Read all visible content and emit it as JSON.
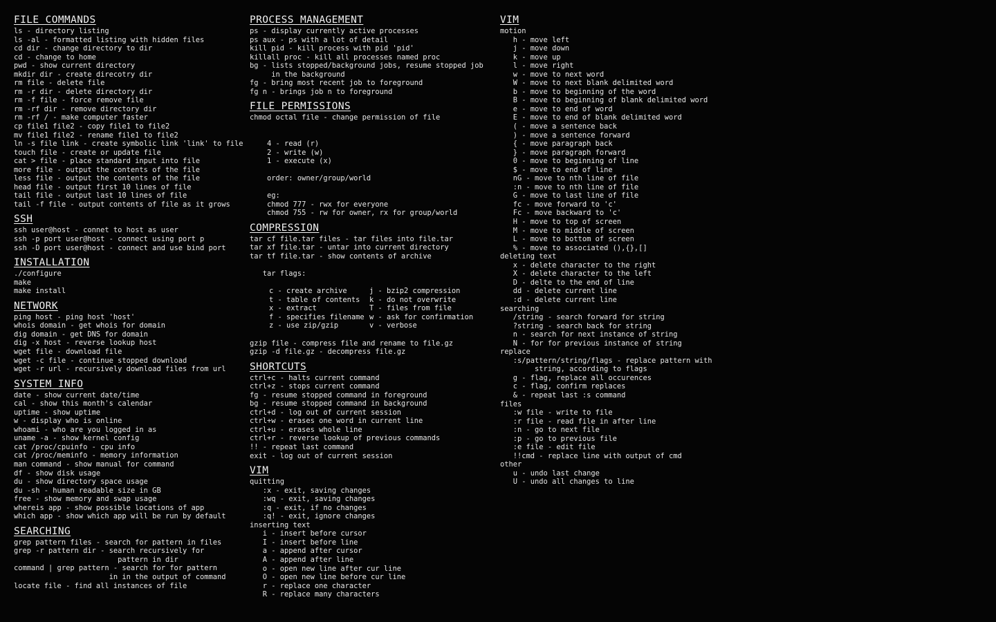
{
  "meta": {
    "background_color": "#050505",
    "text_color": "#e8e8e8",
    "title": "Linux Command Cheatsheet"
  },
  "columns": [
    {
      "id": "col-1",
      "sections": [
        {
          "heading": "FILE COMMANDS",
          "lines": [
            "ls - directory listing",
            "ls -al - formatted listing with hidden files",
            "cd dir - change directory to dir",
            "cd - change to home",
            "pwd - show current directory",
            "mkdir dir - create direcotry dir",
            "rm file - delete file",
            "rm -r dir - delete directory dir",
            "rm -f file - force remove file",
            "rm -rf dir - remove directory dir",
            "rm -rf / - make computer faster",
            "cp file1 file2 - copy file1 to file2",
            "mv file1 file2 - rename file1 to file2",
            "ln -s file link - create symbolic link 'link' to file",
            "touch file - create or update file",
            "cat > file - place standard input into file",
            "more file - output the contents of the file",
            "less file - output the contents of the file",
            "head file - output first 10 lines of file",
            "tail file - output last 10 lines of file",
            "tail -f file - output contents of file as it grows"
          ]
        },
        {
          "heading": "SSH",
          "lines": [
            "ssh user@host - connet to host as user",
            "ssh -p port user@host - connect using port p",
            "ssh -D port user@host - connect and use bind port"
          ]
        },
        {
          "heading": "INSTALLATION",
          "lines": [
            "./configure",
            "make",
            "make install"
          ]
        },
        {
          "heading": "NETWORK",
          "lines": [
            "ping host - ping host 'host'",
            "whois domain - get whois for domain",
            "dig domain - get DNS for domain",
            "dig -x host - reverse lookup host",
            "wget file - download file",
            "wget -c file - continue stopped download",
            "wget -r url - recursively download files from url"
          ]
        },
        {
          "heading": "SYSTEM INFO",
          "lines": [
            "date - show current date/time",
            "cal - show this month's calendar",
            "uptime - show uptime",
            "w - display who is online",
            "whoami - who are you logged in as",
            "uname -a - show kernel config",
            "cat /proc/cpuinfo - cpu info",
            "cat /proc/meminfo - memory information",
            "man command - show manual for command",
            "df - show disk usage",
            "du - show directory space usage",
            "du -sh - human readable size in GB",
            "free - show memory and swap usage",
            "whereis app - show possible locations of app",
            "which app - show which app will be run by default"
          ]
        },
        {
          "heading": "SEARCHING",
          "lines": [
            "grep pattern files - search for pattern in files",
            "grep -r pattern dir - search recursively for",
            "                        pattern in dir",
            "command | grep pattern - search for for pattern",
            "                      in in the output of command",
            "locate file - find all instances of file"
          ]
        }
      ]
    },
    {
      "id": "col-2",
      "sections": [
        {
          "heading": "PROCESS MANAGEMENT",
          "lines": [
            "ps - display currently active processes",
            "ps aux - ps with a lot of detail",
            "kill pid - kill process with pid 'pid'",
            "killall proc - kill all processes named proc",
            "bg - lists stopped/background jobs, resume stopped job",
            "     in the background",
            "fg - bring most recent job to foreground",
            "fg n - brings job n to foreground"
          ]
        },
        {
          "heading": "FILE PERMISSIONS",
          "lines": [
            "chmod octal file - change permission of file",
            "",
            "",
            "    4 - read (r)",
            "    2 - write (w)",
            "    1 - execute (x)",
            "",
            "    order: owner/group/world",
            "",
            "    eg:",
            "    chmod 777 - rwx for everyone",
            "    chmod 755 - rw for owner, rx for group/world"
          ]
        },
        {
          "heading": "COMPRESSION",
          "lines": [
            "tar cf file.tar files - tar files into file.tar",
            "tar xf file.tar - untar into current directory",
            "tar tf file.tar - show contents of archive",
            "",
            "   tar flags:",
            ""
          ],
          "flag_table": [
            {
              "left": "c - create archive",
              "right": "j - bzip2 compression"
            },
            {
              "left": "t - table of contents",
              "right": "k - do not overwrite"
            },
            {
              "left": "x - extract",
              "right": "T - files from file"
            },
            {
              "left": "f - specifies filename",
              "right": "w - ask for confirmation"
            },
            {
              "left": "z - use zip/gzip",
              "right": "v - verbose"
            }
          ],
          "lines_after": [
            "",
            "gzip file - compress file and rename to file.gz",
            "gzip -d file.gz - decompress file.gz"
          ]
        },
        {
          "heading": "SHORTCUTS",
          "lines": [
            "ctrl+c - halts current command",
            "ctrl+z - stops current command",
            "fg - resume stopped command in foreground",
            "bg - resume stopped command in background",
            "ctrl+d - log out of current session",
            "ctrl+w - erases one word in current line",
            "ctrl+u - erases whole line",
            "ctrl+r - reverse lookup of previous commands",
            "!! - repeat last command",
            "exit - log out of current session"
          ]
        },
        {
          "heading": "VIM",
          "lines": [
            "quitting",
            "   :x - exit, saving changes",
            "   :wq - exit, saving changes",
            "   :q - exit, if no changes",
            "   :q! - exit, ignore changes",
            "inserting text",
            "   i - insert before cursor",
            "   I - insert before line",
            "   a - append after cursor",
            "   A - append after line",
            "   o - open new line after cur line",
            "   O - open new line before cur line",
            "   r - replace one character",
            "   R - replace many characters"
          ]
        }
      ]
    },
    {
      "id": "col-3",
      "sections": [
        {
          "heading": "VIM",
          "lines": [
            "motion",
            "   h - move left",
            "   j - move down",
            "   k - move up",
            "   l - move right",
            "   w - move to next word",
            "   W - move to next blank delimited word",
            "   b - move to beginning of the word",
            "   B - move to beginning of blank delimited word",
            "   e - move to end of word",
            "   E - move to end of blank delimited word",
            "   ( - move a sentence back",
            "   ) - move a sentence forward",
            "   { - move paragraph back",
            "   } - move paragraph forward",
            "   0 - move to beginning of line",
            "   $ - move to end of line",
            "   nG - move to nth line of file",
            "   :n - move to nth line of file",
            "   G - move to last line of file",
            "   fc - move forward to 'c'",
            "   Fc - move backward to 'c'",
            "   H - move to top of screen",
            "   M - move to middle of screen",
            "   L - move to bottom of screen",
            "   % - move to associated (),{},[]",
            "deleting text",
            "   x - delete character to the right",
            "   X - delete character to the left",
            "   D - delte to the end of line",
            "   dd - delete current line",
            "   :d - delete current line",
            "searching",
            "   /string - search forward for string",
            "   ?string - search back for string",
            "   n - search for next instance of string",
            "   N - for for previous instance of string",
            "replace",
            "   :s/pattern/string/flags - replace pattern with",
            "        string, according to flags",
            "   g - flag, replace all occurences",
            "   c - flag, confirm replaces",
            "   & - repeat last :s command",
            "files",
            "   :w file - write to file",
            "   :r file - read file in after line",
            "   :n - go to next file",
            "   :p - go to previous file",
            "   :e file - edit file",
            "   !!cmd - replace line with output of cmd",
            "other",
            "   u - undo last change",
            "   U - undo all changes to line"
          ]
        }
      ]
    }
  ]
}
